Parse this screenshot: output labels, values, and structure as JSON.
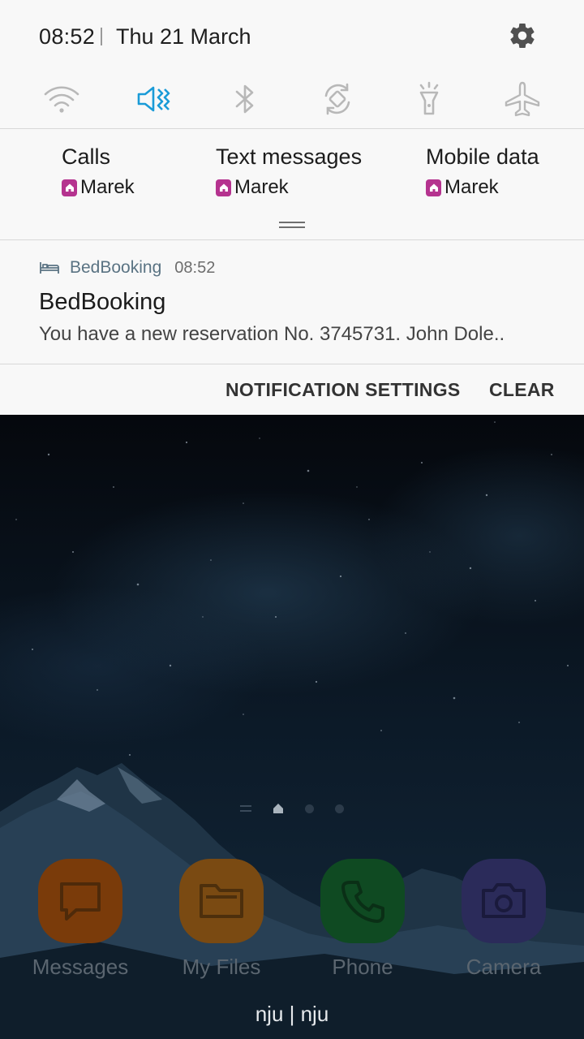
{
  "status": {
    "time": "08:52",
    "date": "Thu 21 March"
  },
  "quick_toggles": [
    {
      "name": "wifi-icon",
      "active": false
    },
    {
      "name": "mute-icon",
      "active": true
    },
    {
      "name": "bluetooth-icon",
      "active": false
    },
    {
      "name": "auto-rotate-icon",
      "active": false
    },
    {
      "name": "flashlight-icon",
      "active": false
    },
    {
      "name": "airplane-mode-icon",
      "active": false
    }
  ],
  "sim_settings": [
    {
      "title": "Calls",
      "sim": "Marek"
    },
    {
      "title": "Text messages",
      "sim": "Marek"
    },
    {
      "title": "Mobile data",
      "sim": "Marek"
    }
  ],
  "notification": {
    "app": "BedBooking",
    "time": "08:52",
    "title": "BedBooking",
    "text": "You have a new reservation No. 3745731. John Dole.."
  },
  "actions": {
    "settings_label": "NOTIFICATION SETTINGS",
    "clear_label": "CLEAR"
  },
  "dock": [
    {
      "label": "Messages",
      "icon": "messages-icon"
    },
    {
      "label": "My Files",
      "icon": "folder-icon"
    },
    {
      "label": "Phone",
      "icon": "phone-icon"
    },
    {
      "label": "Camera",
      "icon": "camera-icon"
    }
  ],
  "carrier": "nju | nju",
  "colors": {
    "accent_active": "#1a9bd7",
    "sim_badge": "#b5338f",
    "panel_bg": "#f8f8f8"
  }
}
